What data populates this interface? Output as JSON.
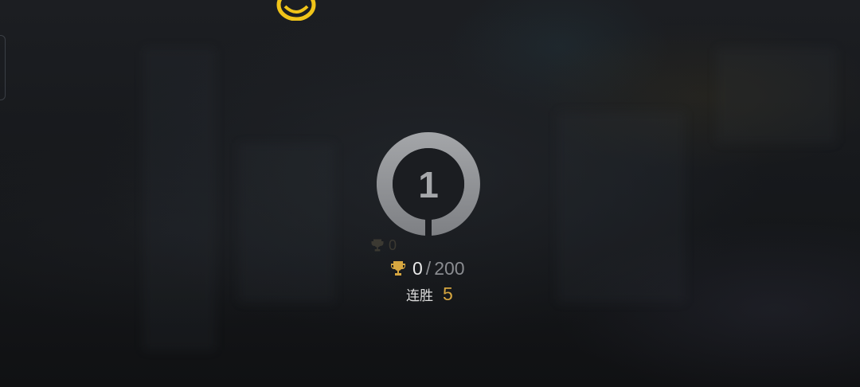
{
  "rank": {
    "number": "1"
  },
  "trophies": {
    "ghost_value": "0",
    "current": "0",
    "separator": "/",
    "max": "200"
  },
  "streak": {
    "label": "连胜",
    "value": "5"
  },
  "colors": {
    "gold": "#d6a640",
    "emblem": "#f0c419",
    "badge": "#8d8f92",
    "background": "#16181c"
  },
  "icons": {
    "top_emblem": "gold-emblem-icon",
    "trophy": "trophy-icon"
  }
}
